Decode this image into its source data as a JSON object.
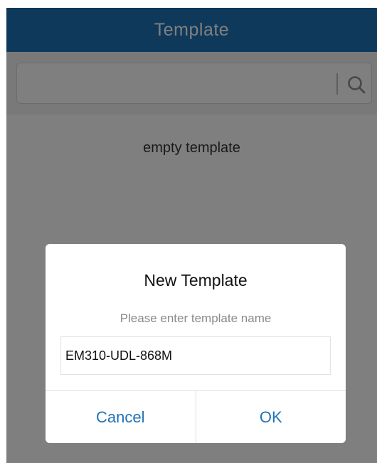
{
  "header": {
    "title": "Template"
  },
  "search": {
    "placeholder": "",
    "value": "",
    "icon": "search-icon"
  },
  "main": {
    "empty_text": "empty template"
  },
  "dialog": {
    "title": "New Template",
    "message": "Please enter template name",
    "input_value": "EM310-UDL-868M",
    "cancel_label": "Cancel",
    "ok_label": "OK"
  },
  "colors": {
    "header": "#1f73b7",
    "accent": "#1f73b7",
    "scrim": "rgba(0,0,0,0.5)"
  }
}
